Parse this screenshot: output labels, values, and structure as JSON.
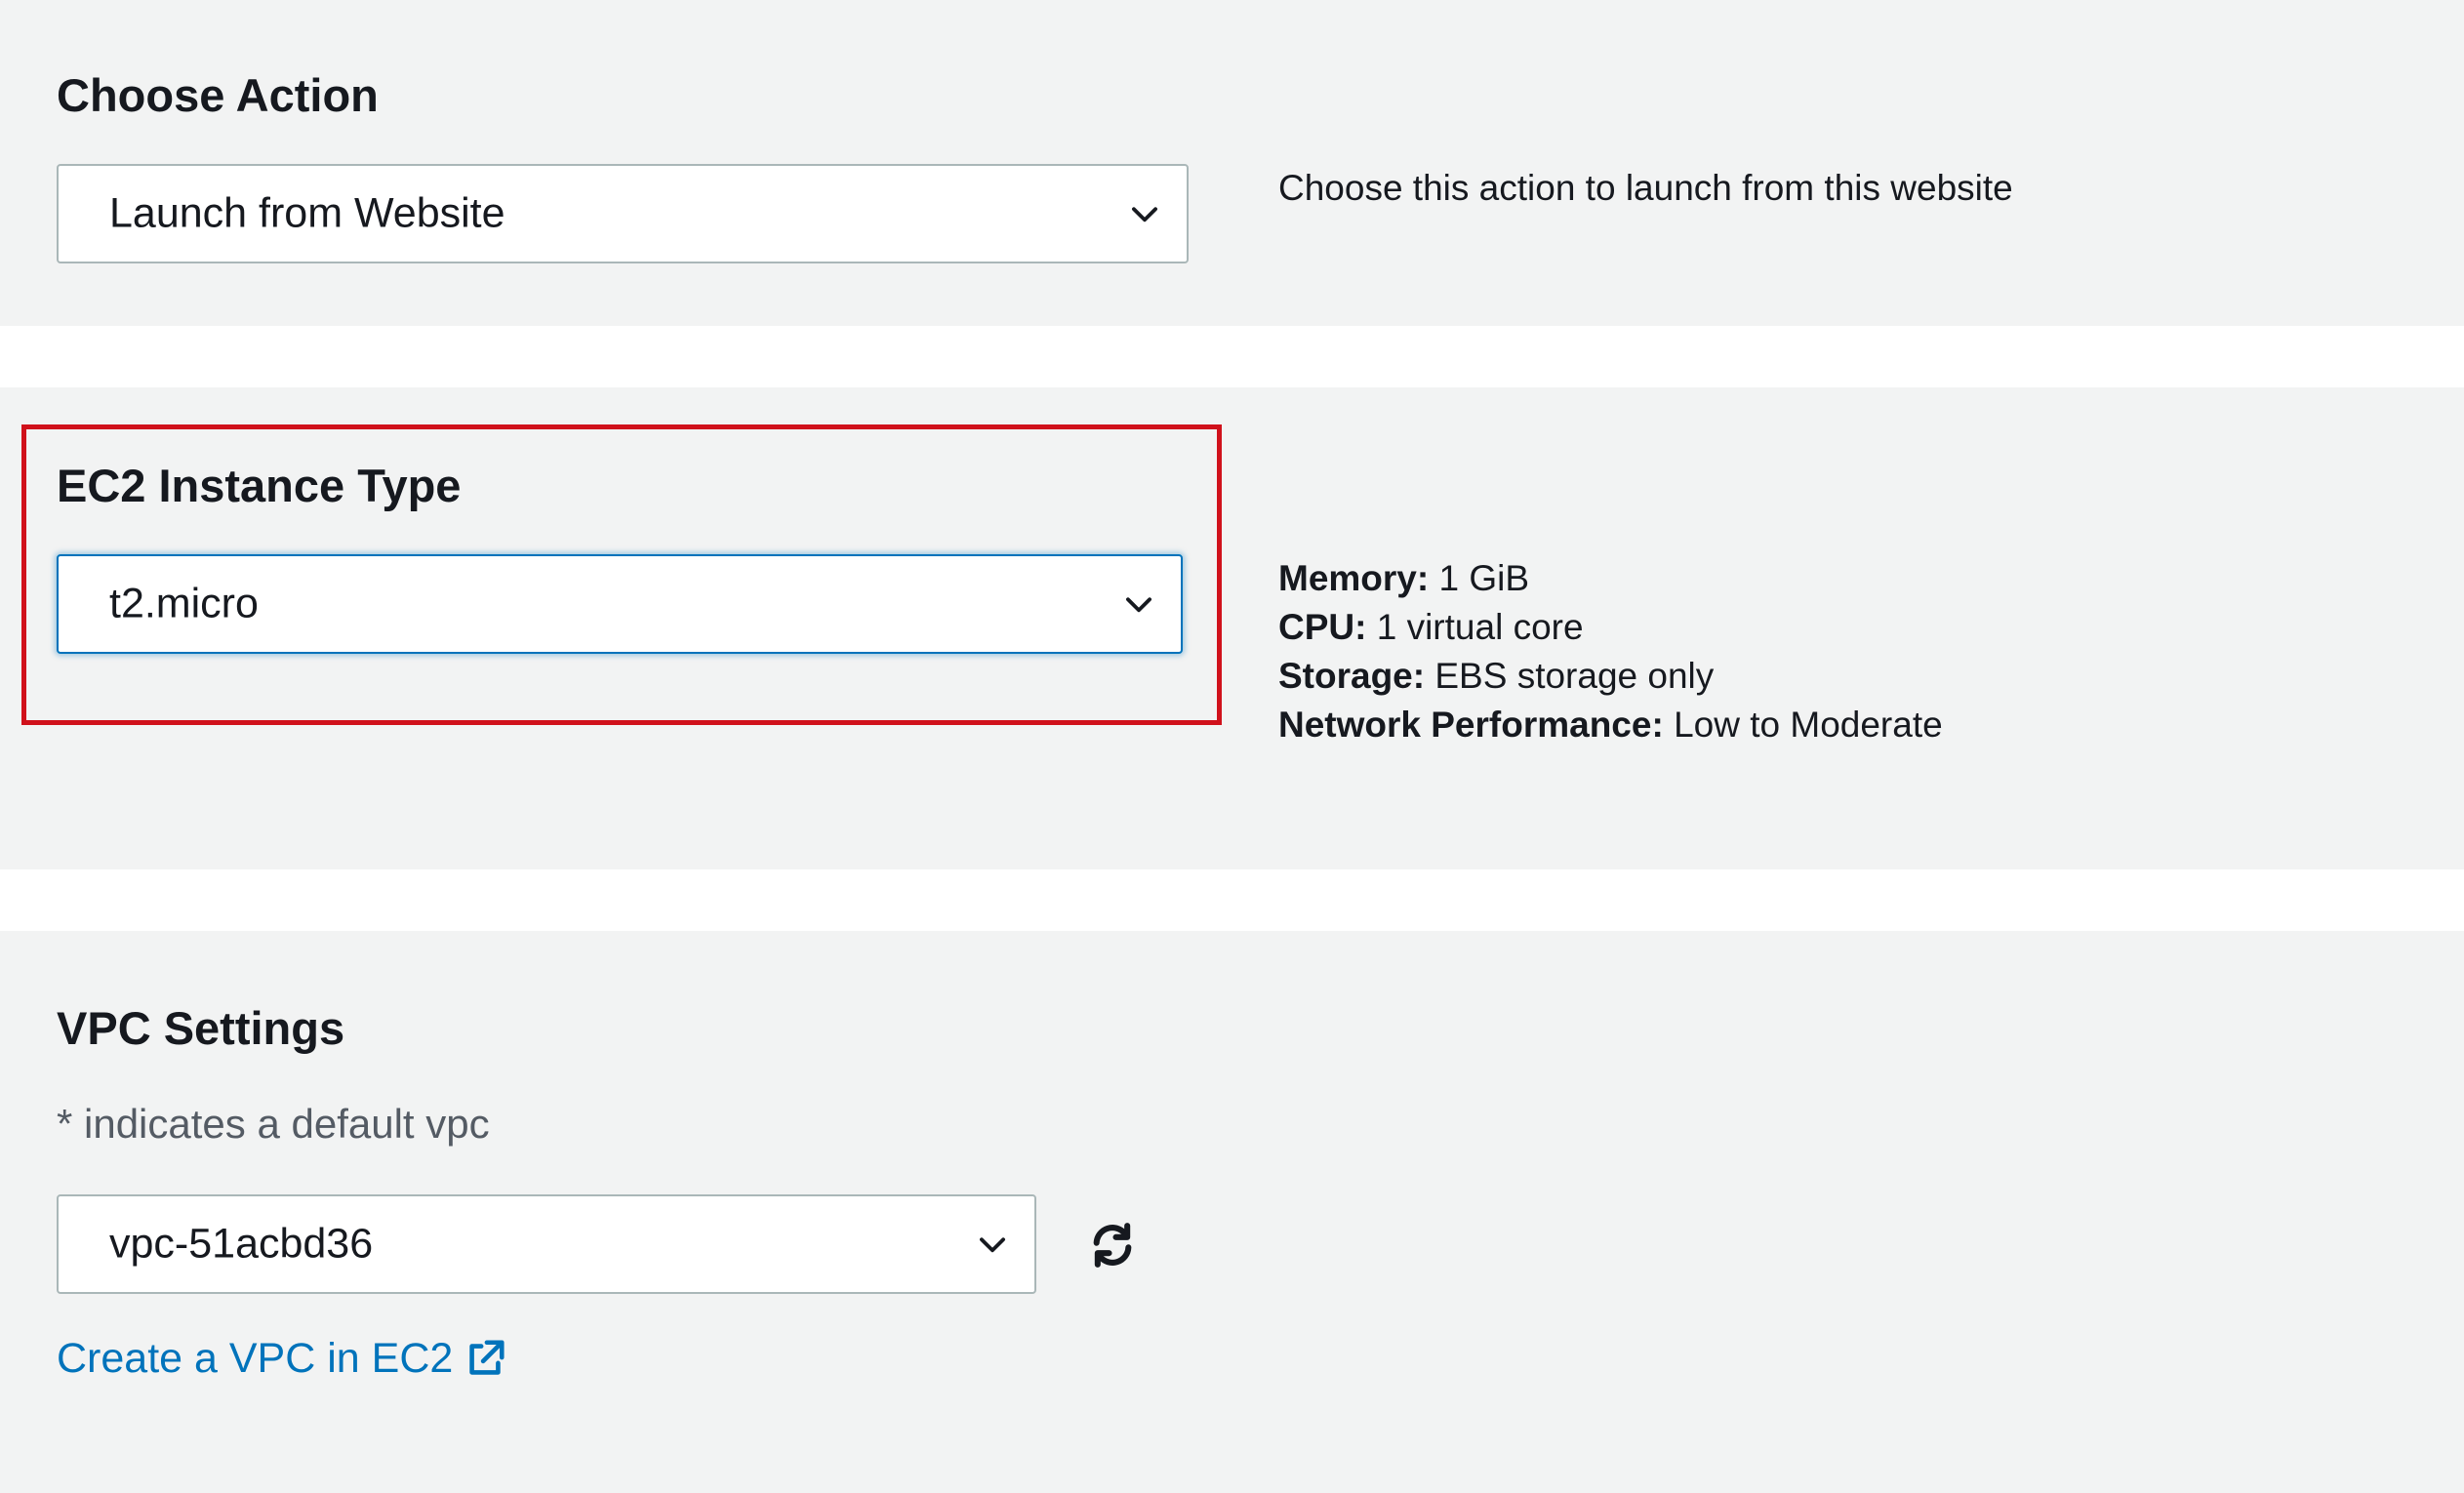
{
  "choose_action": {
    "title": "Choose Action",
    "selected": "Launch from Website",
    "description": "Choose this action to launch from this website"
  },
  "instance_type": {
    "title": "EC2 Instance Type",
    "selected": "t2.micro",
    "specs": [
      {
        "label": "Memory",
        "value": "1 GiB"
      },
      {
        "label": "CPU",
        "value": "1 virtual core"
      },
      {
        "label": "Storage",
        "value": "EBS storage only"
      },
      {
        "label": "Network Performance",
        "value": "Low to Moderate"
      }
    ]
  },
  "vpc": {
    "title": "VPC Settings",
    "hint": "* indicates a default vpc",
    "selected": "vpc-51acbd36",
    "create_link": "Create a VPC in EC2"
  },
  "colors": {
    "highlight": "#d0111b",
    "link": "#0073bb",
    "focus": "#0073bb",
    "panel_bg": "#f2f3f3"
  },
  "icons": [
    "chevron-down-icon",
    "refresh-icon",
    "external-link-icon"
  ]
}
